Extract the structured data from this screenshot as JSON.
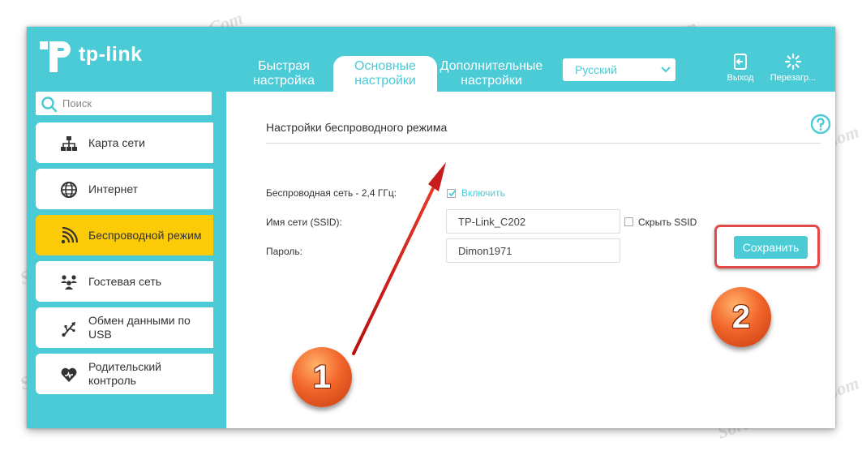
{
  "brand": {
    "logo_text": "tp-link"
  },
  "tabs": [
    {
      "line1": "Быстрая",
      "line2": "настройка"
    },
    {
      "line1": "Основные",
      "line2": "настройки"
    },
    {
      "line1": "Дополнительные",
      "line2": "настройки"
    }
  ],
  "language": {
    "selected": "Русский"
  },
  "top_buttons": {
    "exit": "Выход",
    "reboot": "Перезагр..."
  },
  "search": {
    "placeholder": "Поиск"
  },
  "sidebar": {
    "items": [
      {
        "label": "Карта сети",
        "icon": "network-map-icon"
      },
      {
        "label": "Интернет",
        "icon": "globe-icon"
      },
      {
        "label": "Беспроводной режим",
        "icon": "wireless-icon"
      },
      {
        "label": "Гостевая сеть",
        "icon": "guest-network-icon"
      },
      {
        "label": "Обмен данными по USB",
        "icon": "usb-icon"
      },
      {
        "label": "Родительский контроль",
        "icon": "heart-icon"
      }
    ],
    "active_index": 2
  },
  "content": {
    "title": "Настройки беспроводного режима",
    "wireless_label": "Беспроводная сеть - 2,4 ГГц:",
    "enable_label": "Включить",
    "enable_checked": true,
    "ssid_label": "Имя сети (SSID):",
    "ssid_value": "TP-Link_C202",
    "hide_ssid_label": "Скрыть SSID",
    "hide_ssid_checked": false,
    "password_label": "Пароль:",
    "password_value": "Dimon1971",
    "save_label": "Сохранить"
  },
  "annotations": {
    "badge1": "1",
    "badge2": "2"
  },
  "watermark": "Soringpcrepair.Com",
  "colors": {
    "accent": "#4acbd6",
    "active": "#fccb07",
    "highlight": "#e24a4a"
  }
}
